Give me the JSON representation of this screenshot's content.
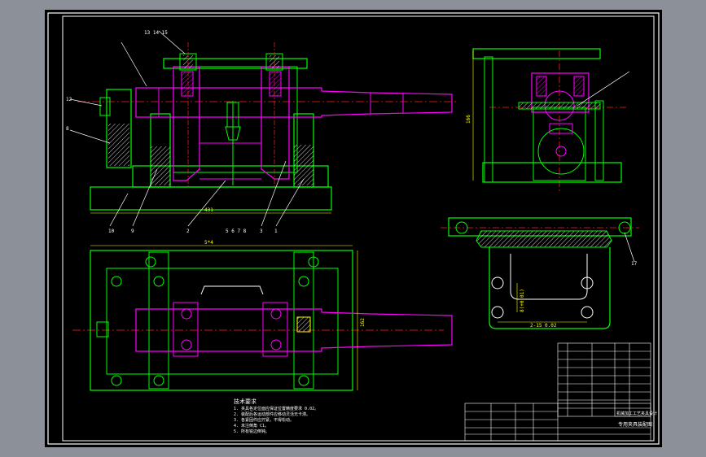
{
  "drawing": {
    "colors": {
      "background": "#000000",
      "frame": "#ffffff",
      "outline": "#00ff00",
      "part": "#ff00ff",
      "center": "#ff2020",
      "dimension": "#ffff00",
      "hatch": "#ffffff",
      "window": "#8c9099"
    },
    "dimensions": {
      "front_width": "431",
      "top_width": "5*4",
      "top_height": "162",
      "side_height": "166",
      "side_bolt_v": "8(+0.01)",
      "side_bolt_h": "2-15 0.02"
    },
    "balloons": {
      "top_group": "13 14 15",
      "front_left_a": "12",
      "front_left_b": "8",
      "front_bottom": [
        "10",
        "9",
        "2",
        "3",
        "1"
      ],
      "front_bottom_mid": "5 6 7 8",
      "side_right": "17"
    },
    "tech_requirements": {
      "title": "技术要求",
      "lines": [
        "1. 夹具各定位面应保证位置精度要求 0.02。",
        "2. 装配后各运动部件应移动灵活无卡滞。",
        "3. 各紧固件应拧紧，不得松动。",
        "4. 未注倒角 C1。",
        "5. 所有锐边倒钝。"
      ]
    },
    "title_block": {
      "title": "专用夹具装配图",
      "org": "机械加工工艺夹具设计"
    }
  }
}
